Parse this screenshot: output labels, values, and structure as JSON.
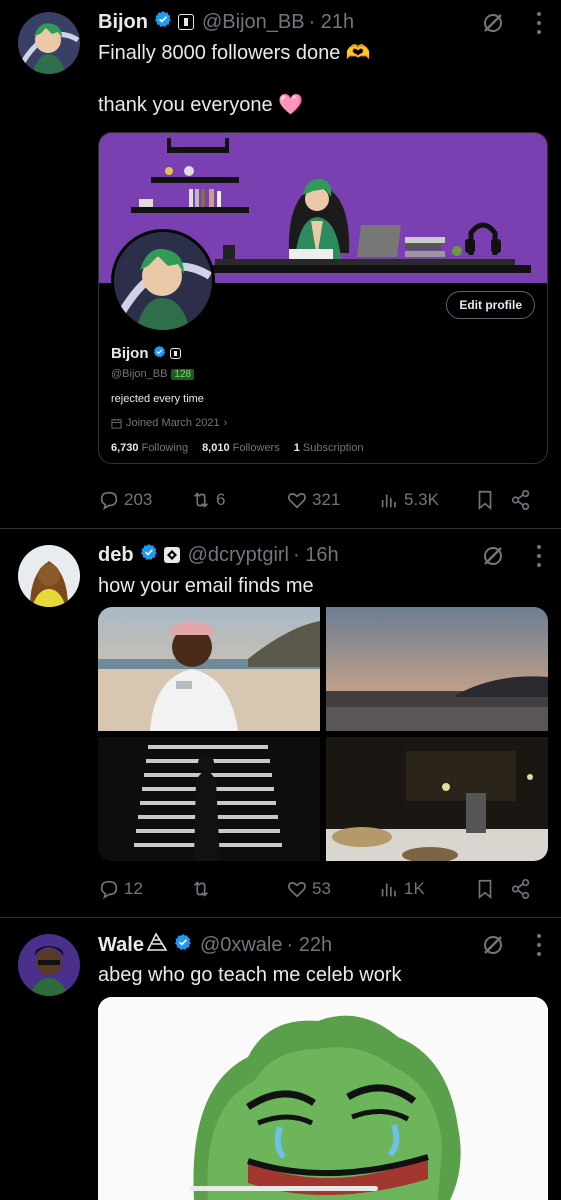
{
  "colors": {
    "background": "#000000",
    "text": "#e7e9ea",
    "muted": "#71767b",
    "verified": "#1d9bf0",
    "divider": "#2f3336",
    "banner": "#7a3fb0"
  },
  "tweets": [
    {
      "name": "Bijon",
      "handle": "@Bijon_BB",
      "time": "· 21h",
      "text1": "Finally 8000 followers done 🫶",
      "text2": "thank you everyone 🩷",
      "card": {
        "name": "Bijon",
        "handle": "@Bijon_BB",
        "handle_num": "128",
        "edit_label": "Edit profile",
        "bio": "rejected every time",
        "joined": "Joined March 2021",
        "following_count": "6,730",
        "following_label": "Following",
        "followers_count": "8,010",
        "followers_label": "Followers",
        "subscription_count": "1",
        "subscription_label": "Subscription"
      },
      "replies": "203",
      "reposts": "6",
      "likes": "321",
      "views": "5.3K"
    },
    {
      "name": "deb",
      "handle": "@dcryptgirl",
      "time": "· 16h",
      "text1": "how your email finds me",
      "replies": "12",
      "reposts": "",
      "likes": "53",
      "views": "1K"
    },
    {
      "name": "Wale",
      "handle": "@0xwale",
      "time": "· 22h",
      "text1": "abeg who go teach me celeb work"
    }
  ],
  "icons": [
    "verified-icon",
    "grok-icon",
    "more-icon",
    "reply-icon",
    "repost-icon",
    "like-icon",
    "views-icon",
    "bookmark-icon",
    "share-icon",
    "calendar-icon"
  ]
}
